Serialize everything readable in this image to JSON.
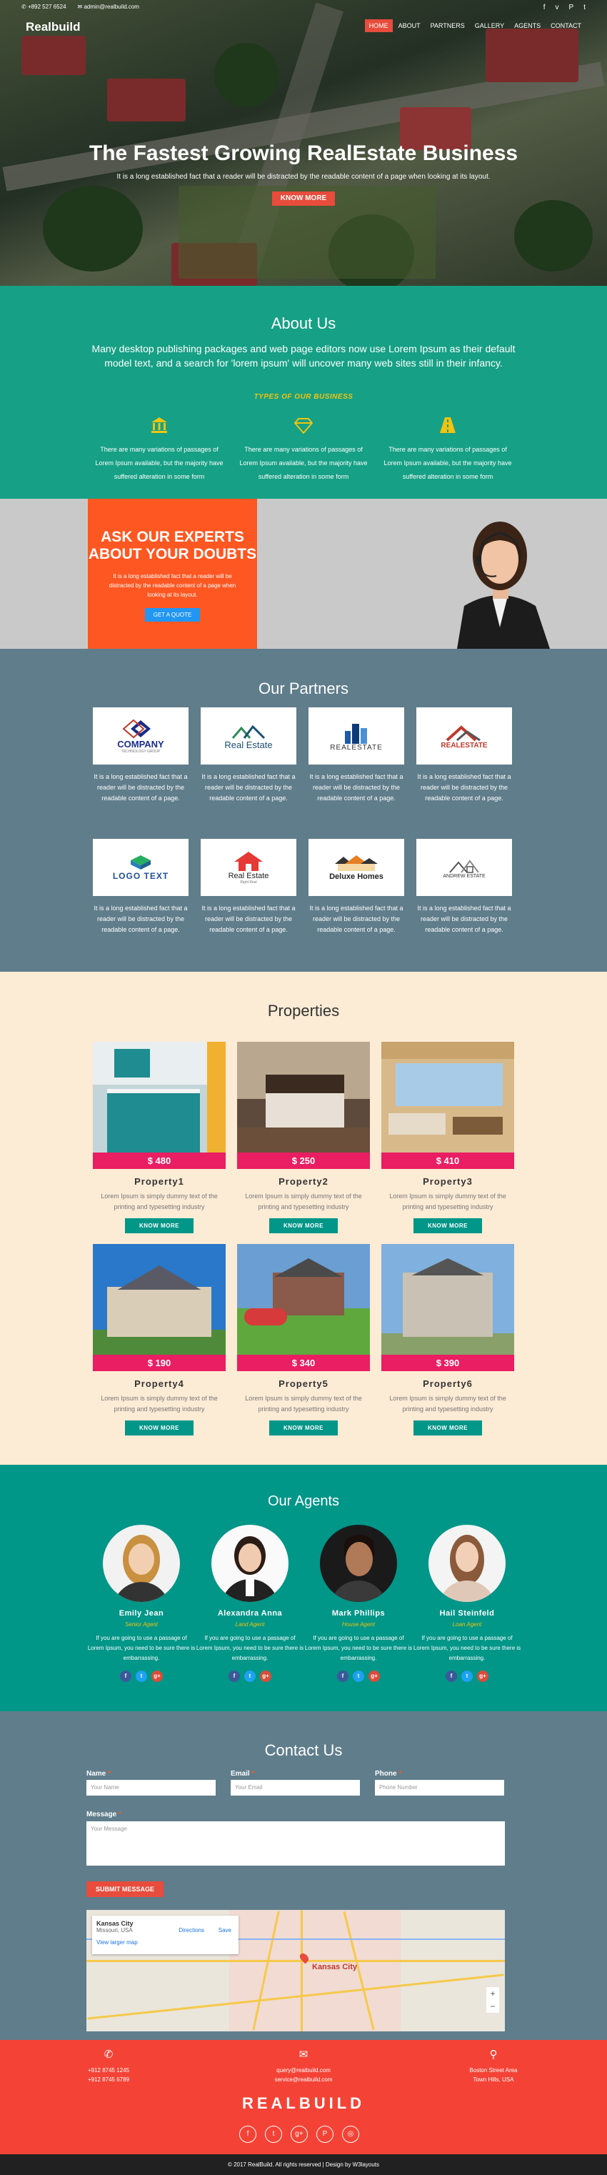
{
  "topbar": {
    "phone": "+892 527 6524",
    "email": "admin@realbuild.com",
    "social_icons": [
      "facebook-icon",
      "vimeo-icon",
      "pinterest-icon",
      "twitter-icon"
    ]
  },
  "brand": "Realbuild",
  "nav": [
    "HOME",
    "ABOUT",
    "PARTNERS",
    "GALLERY",
    "AGENTS",
    "CONTACT"
  ],
  "hero": {
    "title": "The Fastest Growing RealEstate Business",
    "subtitle": "It is a long established fact that a reader will be distracted by the readable content of a page when looking at its layout.",
    "button": "KNOW MORE"
  },
  "about": {
    "title": "About Us",
    "lead": "Many desktop publishing packages and web page editors now use Lorem Ipsum as their default model text, and a search for 'lorem ipsum' will uncover many web sites still in their infancy.",
    "types": "TYPES OF OUR BUSINESS",
    "cols": [
      {
        "icon": "bank-icon",
        "text": "There are many variations of passages of Lorem Ipsum available, but the majority have suffered alteration in some form"
      },
      {
        "icon": "diamond-icon",
        "text": "There are many variations of passages of Lorem Ipsum available, but the majority have suffered alteration in some form"
      },
      {
        "icon": "road-icon",
        "text": "There are many variations of passages of Lorem Ipsum available, but the majority have suffered alteration in some form"
      }
    ]
  },
  "ask": {
    "title": "ASK OUR EXPERTS ABOUT YOUR DOUBTS",
    "text": "It is a long established fact that a reader will be distracted by the readable content of a page when looking at its layout.",
    "button": "GET A QUOTE"
  },
  "partners": {
    "title": "Our Partners",
    "text": "It is a long established fact that a reader will be distracted by the readable content of a page.",
    "logos": [
      {
        "name": "COMPANY",
        "sub": "TECHNOLOGY GROUP"
      },
      {
        "name": "Real Estate",
        "sub": ""
      },
      {
        "name": "REALESTATE",
        "sub": ""
      },
      {
        "name": "REALESTATE",
        "sub": ""
      },
      {
        "name": "LOGO TEXT",
        "sub": ""
      },
      {
        "name": "Real Estate",
        "sub": "Right Real"
      },
      {
        "name": "Deluxe Homes",
        "sub": ""
      },
      {
        "name": "ANDREW ESTATE",
        "sub": ""
      }
    ]
  },
  "properties": {
    "title": "Properties",
    "desc": "Lorem Ipsum is simply dummy text of the printing and typesetting industry",
    "button": "KNOW MORE",
    "items": [
      {
        "name": "Property1",
        "price": "$ 480"
      },
      {
        "name": "Property2",
        "price": "$ 250"
      },
      {
        "name": "Property3",
        "price": "$ 410"
      },
      {
        "name": "Property4",
        "price": "$ 190"
      },
      {
        "name": "Property5",
        "price": "$ 340"
      },
      {
        "name": "Property6",
        "price": "$ 390"
      }
    ]
  },
  "agents": {
    "title": "Our Agents",
    "text": "If you are going to use a passage of Lorem Ipsum, you need to be sure there is embarrassing.",
    "items": [
      {
        "name": "Emily Jean",
        "role": "Senior Agent"
      },
      {
        "name": "Alexandra Anna",
        "role": "Land Agent"
      },
      {
        "name": "Mark Phillips",
        "role": "House Agent"
      },
      {
        "name": "Hail Steinfeld",
        "role": "Loan Agent"
      }
    ]
  },
  "contact": {
    "title": "Contact Us",
    "name_label": "Name",
    "email_label": "Email",
    "phone_label": "Phone",
    "message_label": "Message",
    "name_ph": "Your Name",
    "email_ph": "Your Email",
    "phone_ph": "Phone Number",
    "message_ph": "Your Message",
    "submit": "SUBMIT MESSAGE",
    "map_city": "Kansas City",
    "map_state": "Missouri, USA",
    "map_link": "View larger map",
    "map_directions": "Directions",
    "map_save": "Save",
    "map_label": "Kansas City"
  },
  "footer": {
    "phones": "+912 8745 1245",
    "phones2": "+912 8745 6789",
    "email1": "query@realbuild.com",
    "email2": "service@realbuild.com",
    "address1": "Boston Street Area",
    "address2": "Town Hills, USA",
    "wordmark": "REALBUILD",
    "copyright": "© 2017 RealBuild. All rights reserved | Design by W3layouts"
  }
}
